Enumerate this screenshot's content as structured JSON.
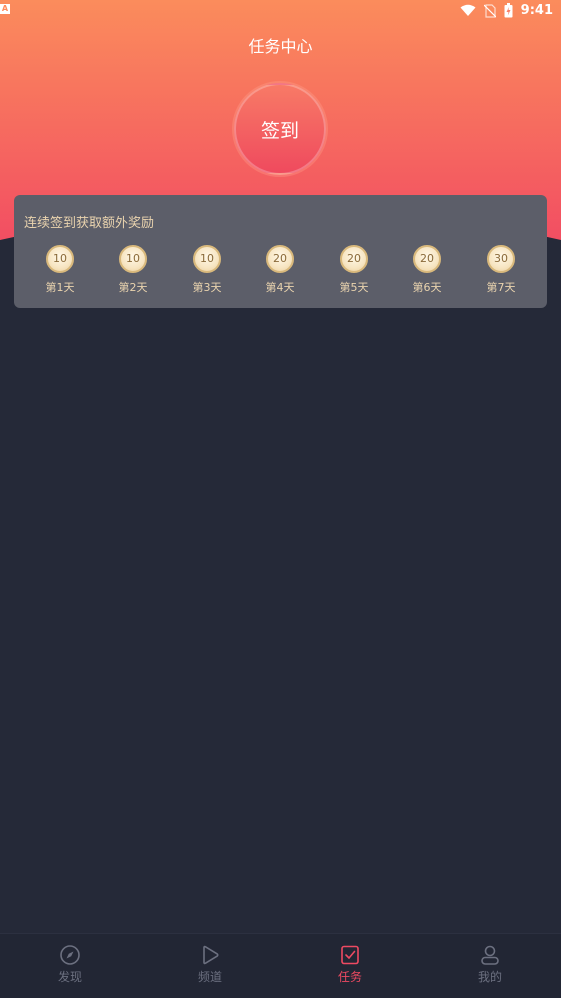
{
  "status_bar": {
    "notification_glyph": "A",
    "time": "9:41"
  },
  "header": {
    "title": "任务中心"
  },
  "checkin": {
    "label": "签到"
  },
  "rewards": {
    "title": "连续签到获取额外奖励",
    "days": [
      {
        "points": "10",
        "label": "第1天"
      },
      {
        "points": "10",
        "label": "第2天"
      },
      {
        "points": "10",
        "label": "第3天"
      },
      {
        "points": "20",
        "label": "第4天"
      },
      {
        "points": "20",
        "label": "第5天"
      },
      {
        "points": "20",
        "label": "第6天"
      },
      {
        "points": "30",
        "label": "第7天"
      }
    ]
  },
  "tabbar": {
    "items": [
      {
        "label": "发现",
        "icon": "compass-icon"
      },
      {
        "label": "频道",
        "icon": "play-icon"
      },
      {
        "label": "任务",
        "icon": "task-check-icon"
      },
      {
        "label": "我的",
        "icon": "user-icon"
      }
    ],
    "active_index": 2
  },
  "colors": {
    "header_top": "#fb8a5e",
    "header_bottom": "#f25562",
    "background": "#252938",
    "card": "#5c5e69",
    "gold_text": "#e9d3ae",
    "accent": "#ee4a62",
    "tab_inactive": "#6c7080"
  }
}
